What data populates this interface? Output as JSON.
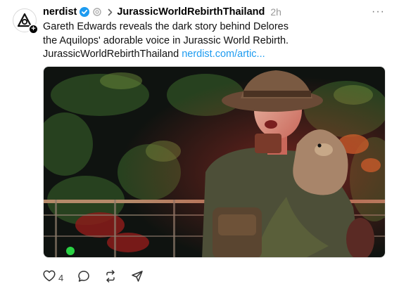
{
  "post": {
    "username": "nerdist",
    "tag": "JurassicWorldRebirthThailand",
    "time": "2h",
    "text_line1": "Gareth Edwards reveals the dark story behind Delores",
    "text_line2": "the Aquilops' adorable voice in Jurassic World Rebirth.",
    "text_line3_tag": "JurassicWorldRebirthThailand",
    "link": "nerdist.com/artic...",
    "more": "···"
  },
  "actions": {
    "like_count": "4",
    "icons": [
      "heart-icon",
      "comment-icon",
      "repost-icon",
      "share-icon"
    ]
  },
  "colors": {
    "link": "#1d9bf0",
    "verified": "#1d9bf0",
    "muted": "#999999"
  }
}
